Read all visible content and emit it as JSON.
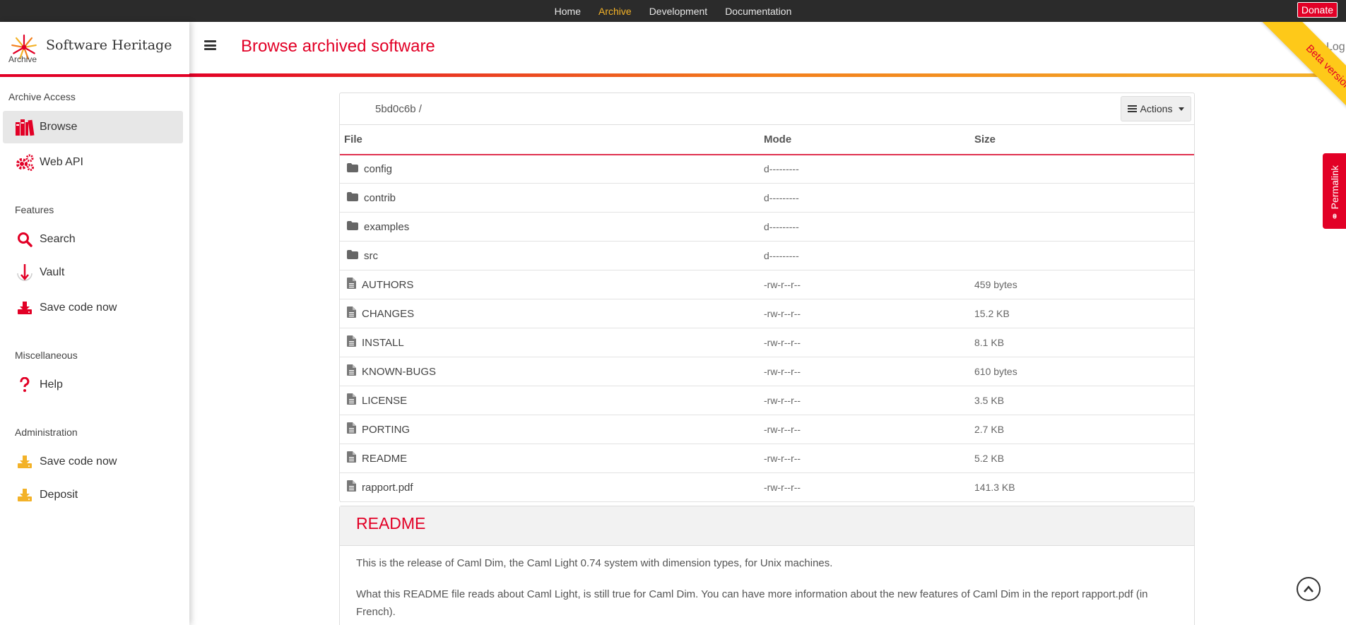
{
  "topnav": {
    "links": [
      "Home",
      "Archive",
      "Development",
      "Documentation"
    ],
    "active": "Archive",
    "donate_label": "Donate"
  },
  "brand": {
    "name": "Software Heritage",
    "subtitle": "Archive"
  },
  "sidebar": {
    "sections": [
      {
        "title": "Archive Access",
        "items": [
          {
            "label": "Browse",
            "icon": "books-icon",
            "active": true
          },
          {
            "label": "Web API",
            "icon": "gears-icon"
          }
        ]
      },
      {
        "title": "Features",
        "items": [
          {
            "label": "Search",
            "icon": "search-icon"
          },
          {
            "label": "Vault",
            "icon": "vault-arrow-icon"
          },
          {
            "label": "Save code now",
            "icon": "download-icon"
          }
        ]
      },
      {
        "title": "Miscellaneous",
        "items": [
          {
            "label": "Help",
            "icon": "question-icon"
          }
        ]
      },
      {
        "title": "Administration",
        "items": [
          {
            "label": "Save code now",
            "icon": "download-icon"
          },
          {
            "label": "Deposit",
            "icon": "download-icon"
          }
        ]
      }
    ]
  },
  "header": {
    "title": "Browse archived software",
    "login_label": "Log",
    "beta_label": "Beta version"
  },
  "permalink_label": "Permalink",
  "browse": {
    "breadcrumb": "5bd0c6b /",
    "actions_label": "Actions",
    "columns": [
      "File",
      "Mode",
      "Size"
    ],
    "rows": [
      {
        "name": "config",
        "type": "dir",
        "mode": "d---------",
        "size": ""
      },
      {
        "name": "contrib",
        "type": "dir",
        "mode": "d---------",
        "size": ""
      },
      {
        "name": "examples",
        "type": "dir",
        "mode": "d---------",
        "size": ""
      },
      {
        "name": "src",
        "type": "dir",
        "mode": "d---------",
        "size": ""
      },
      {
        "name": "AUTHORS",
        "type": "file",
        "mode": "-rw-r--r--",
        "size": "459 bytes"
      },
      {
        "name": "CHANGES",
        "type": "file",
        "mode": "-rw-r--r--",
        "size": "15.2 KB"
      },
      {
        "name": "INSTALL",
        "type": "file",
        "mode": "-rw-r--r--",
        "size": "8.1 KB"
      },
      {
        "name": "KNOWN-BUGS",
        "type": "file",
        "mode": "-rw-r--r--",
        "size": "610 bytes"
      },
      {
        "name": "LICENSE",
        "type": "file",
        "mode": "-rw-r--r--",
        "size": "3.5 KB"
      },
      {
        "name": "PORTING",
        "type": "file",
        "mode": "-rw-r--r--",
        "size": "2.7 KB"
      },
      {
        "name": "README",
        "type": "file",
        "mode": "-rw-r--r--",
        "size": "5.2 KB"
      },
      {
        "name": "rapport.pdf",
        "type": "file",
        "mode": "-rw-r--r--",
        "size": "141.3 KB"
      }
    ]
  },
  "readme": {
    "title": "README",
    "paragraphs": [
      "This is the release of Caml Dim, the Caml Light 0.74 system with dimension types, for Unix machines.",
      "What this README file reads about Caml Light, is still true for Caml Dim. You can have more information about the new features of Caml Dim in the report rapport.pdf (in French)."
    ]
  },
  "colors": {
    "brand_red": "#e20026",
    "accent_yellow": "#f3b228",
    "beta_yellow": "#fec919",
    "topnav_bg": "#2b2b2b"
  }
}
